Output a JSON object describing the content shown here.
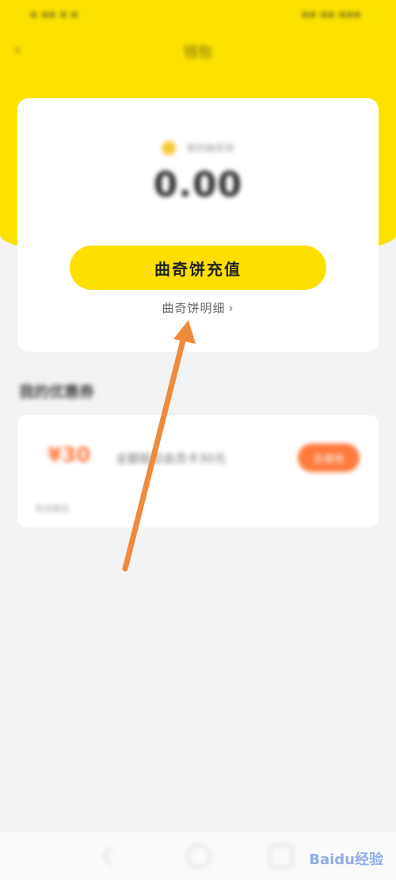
{
  "colors": {
    "yellow": "#fde200",
    "orange": "#ff7a3d",
    "bg": "#f2f3f5"
  },
  "nav": {
    "back_icon": "chevron-left-icon",
    "title": "钱包"
  },
  "wallet": {
    "balance_label": "我的曲奇饼",
    "balance": "0.00",
    "recharge_label": "曲奇饼充值",
    "details_label": "曲奇饼明细",
    "details_icon": "chevron-right-icon"
  },
  "coupons": {
    "title": "我的优惠券",
    "item": {
      "amount": "¥30",
      "description": "全额抵扣会员卡30元",
      "action_label": "去使用",
      "sub_text": "有效期至"
    }
  },
  "annotation": {
    "arrow_color": "#f08a3c"
  },
  "watermark": "Baidu经验"
}
